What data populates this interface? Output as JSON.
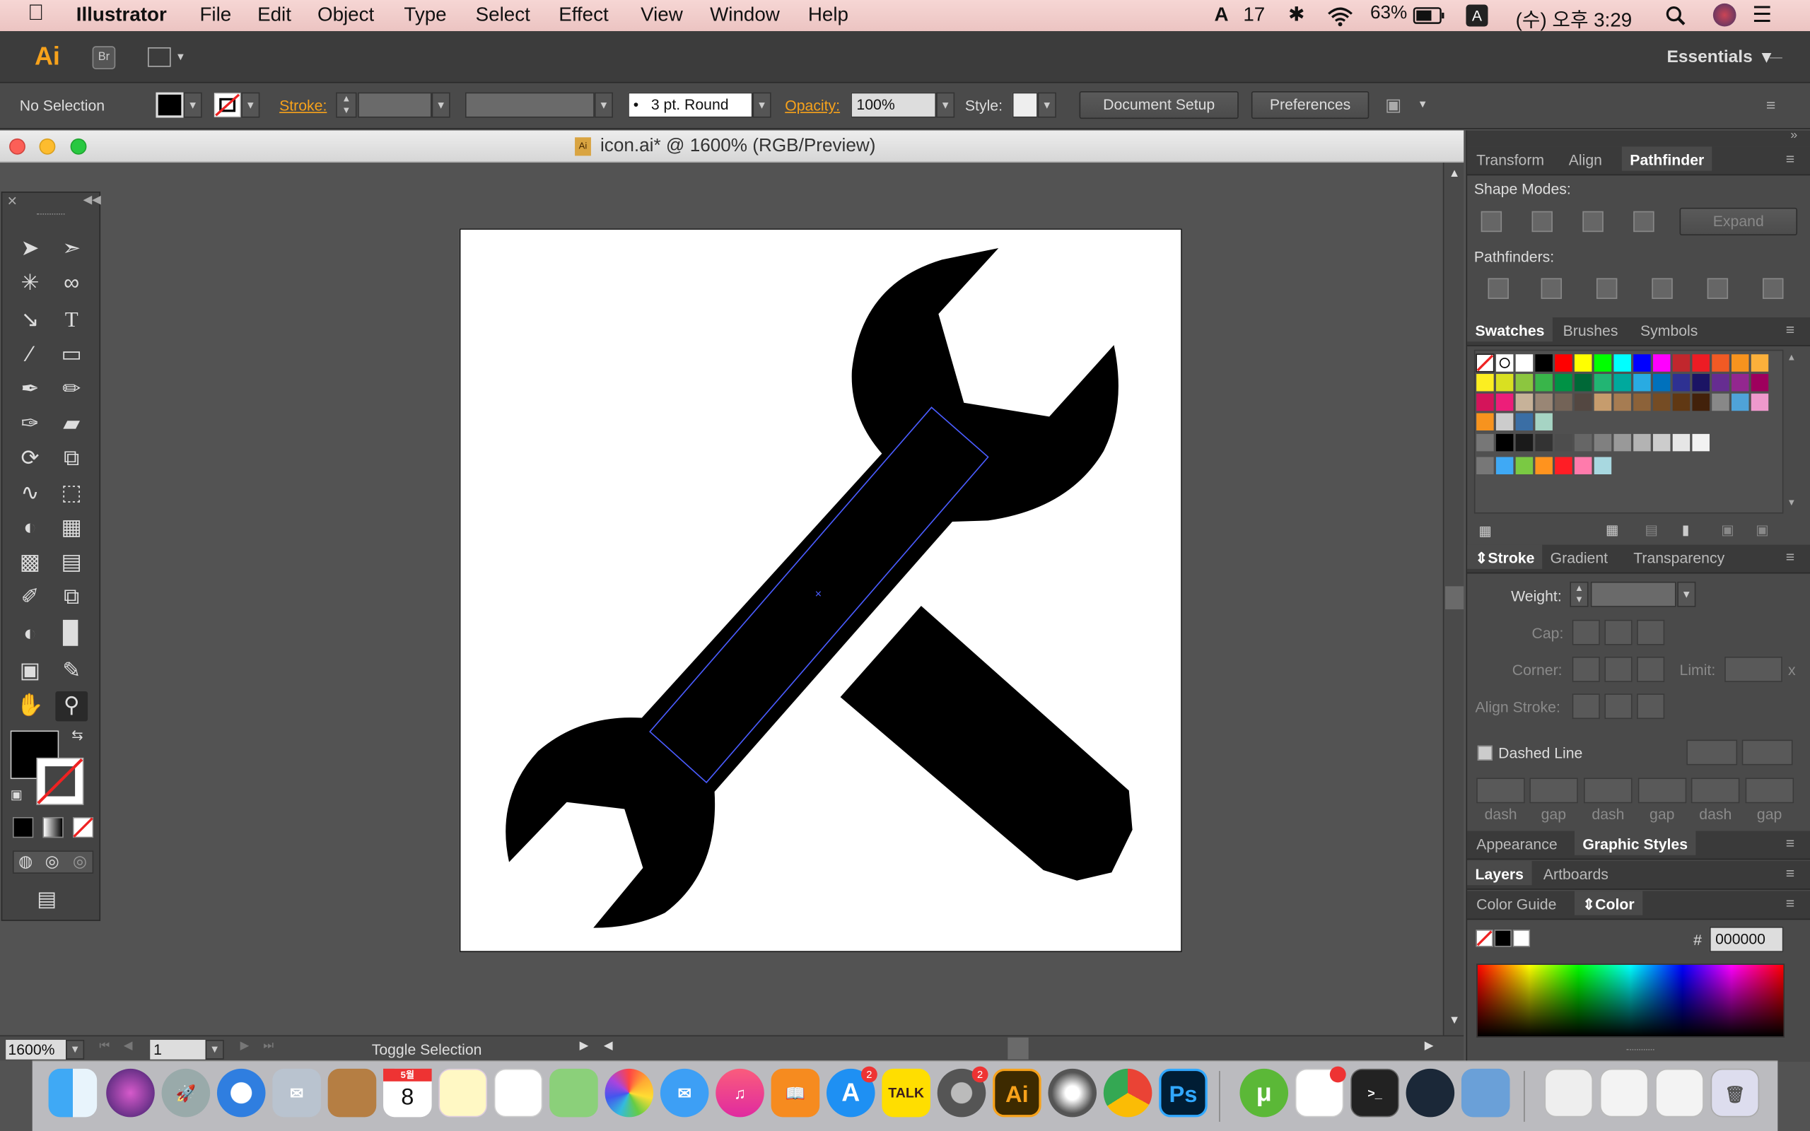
{
  "menubar": {
    "apple": "",
    "app_name": "Illustrator",
    "items": [
      "File",
      "Edit",
      "Object",
      "Type",
      "Select",
      "Effect",
      "View",
      "Window",
      "Help"
    ],
    "status": {
      "adobe_badge": "17",
      "battery": "63%",
      "input": "A",
      "clock": "(수) 오후 3:29"
    }
  },
  "appbar": {
    "logo": "Ai",
    "bridge": "Br",
    "workspace": "Essentials"
  },
  "control_bar": {
    "selection": "No Selection",
    "stroke_label": "Stroke:",
    "brush": "3 pt. Round",
    "opacity_label": "Opacity:",
    "opacity_value": "100%",
    "style_label": "Style:",
    "document_setup": "Document Setup",
    "preferences": "Preferences"
  },
  "document": {
    "title": "icon.ai* @ 1600% (RGB/Preview)",
    "file_badge": "Ai"
  },
  "status_bar": {
    "zoom": "1600%",
    "artboard": "1",
    "mode": "Toggle Selection"
  },
  "panels": {
    "tabs_top": [
      "Transform",
      "Align",
      "Pathfinder"
    ],
    "shape_modes": "Shape Modes:",
    "expand": "Expand",
    "pathfinders": "Pathfinders:",
    "tabs_swatches": [
      "Swatches",
      "Brushes",
      "Symbols"
    ],
    "tabs_stroke": [
      "Stroke",
      "Gradient",
      "Transparency"
    ],
    "weight": "Weight:",
    "cap": "Cap:",
    "corner": "Corner:",
    "limit": "Limit:",
    "limit_x": "x",
    "align_stroke": "Align Stroke:",
    "dashed_line": "Dashed Line",
    "dash_labels": [
      "dash",
      "gap",
      "dash",
      "gap",
      "dash",
      "gap"
    ],
    "tabs_appearance": [
      "Appearance",
      "Graphic Styles"
    ],
    "tabs_layers": [
      "Layers",
      "Artboards"
    ],
    "tabs_color": [
      "Color Guide",
      "Color"
    ],
    "hex_label": "#",
    "hex_value": "000000"
  },
  "dock": {
    "calendar_month": "5월",
    "calendar_day": "8",
    "appstore_badge": "2",
    "sysprefs_badge": "2",
    "kakao": "TALK",
    "ai": "Ai",
    "ps": "Ps"
  }
}
